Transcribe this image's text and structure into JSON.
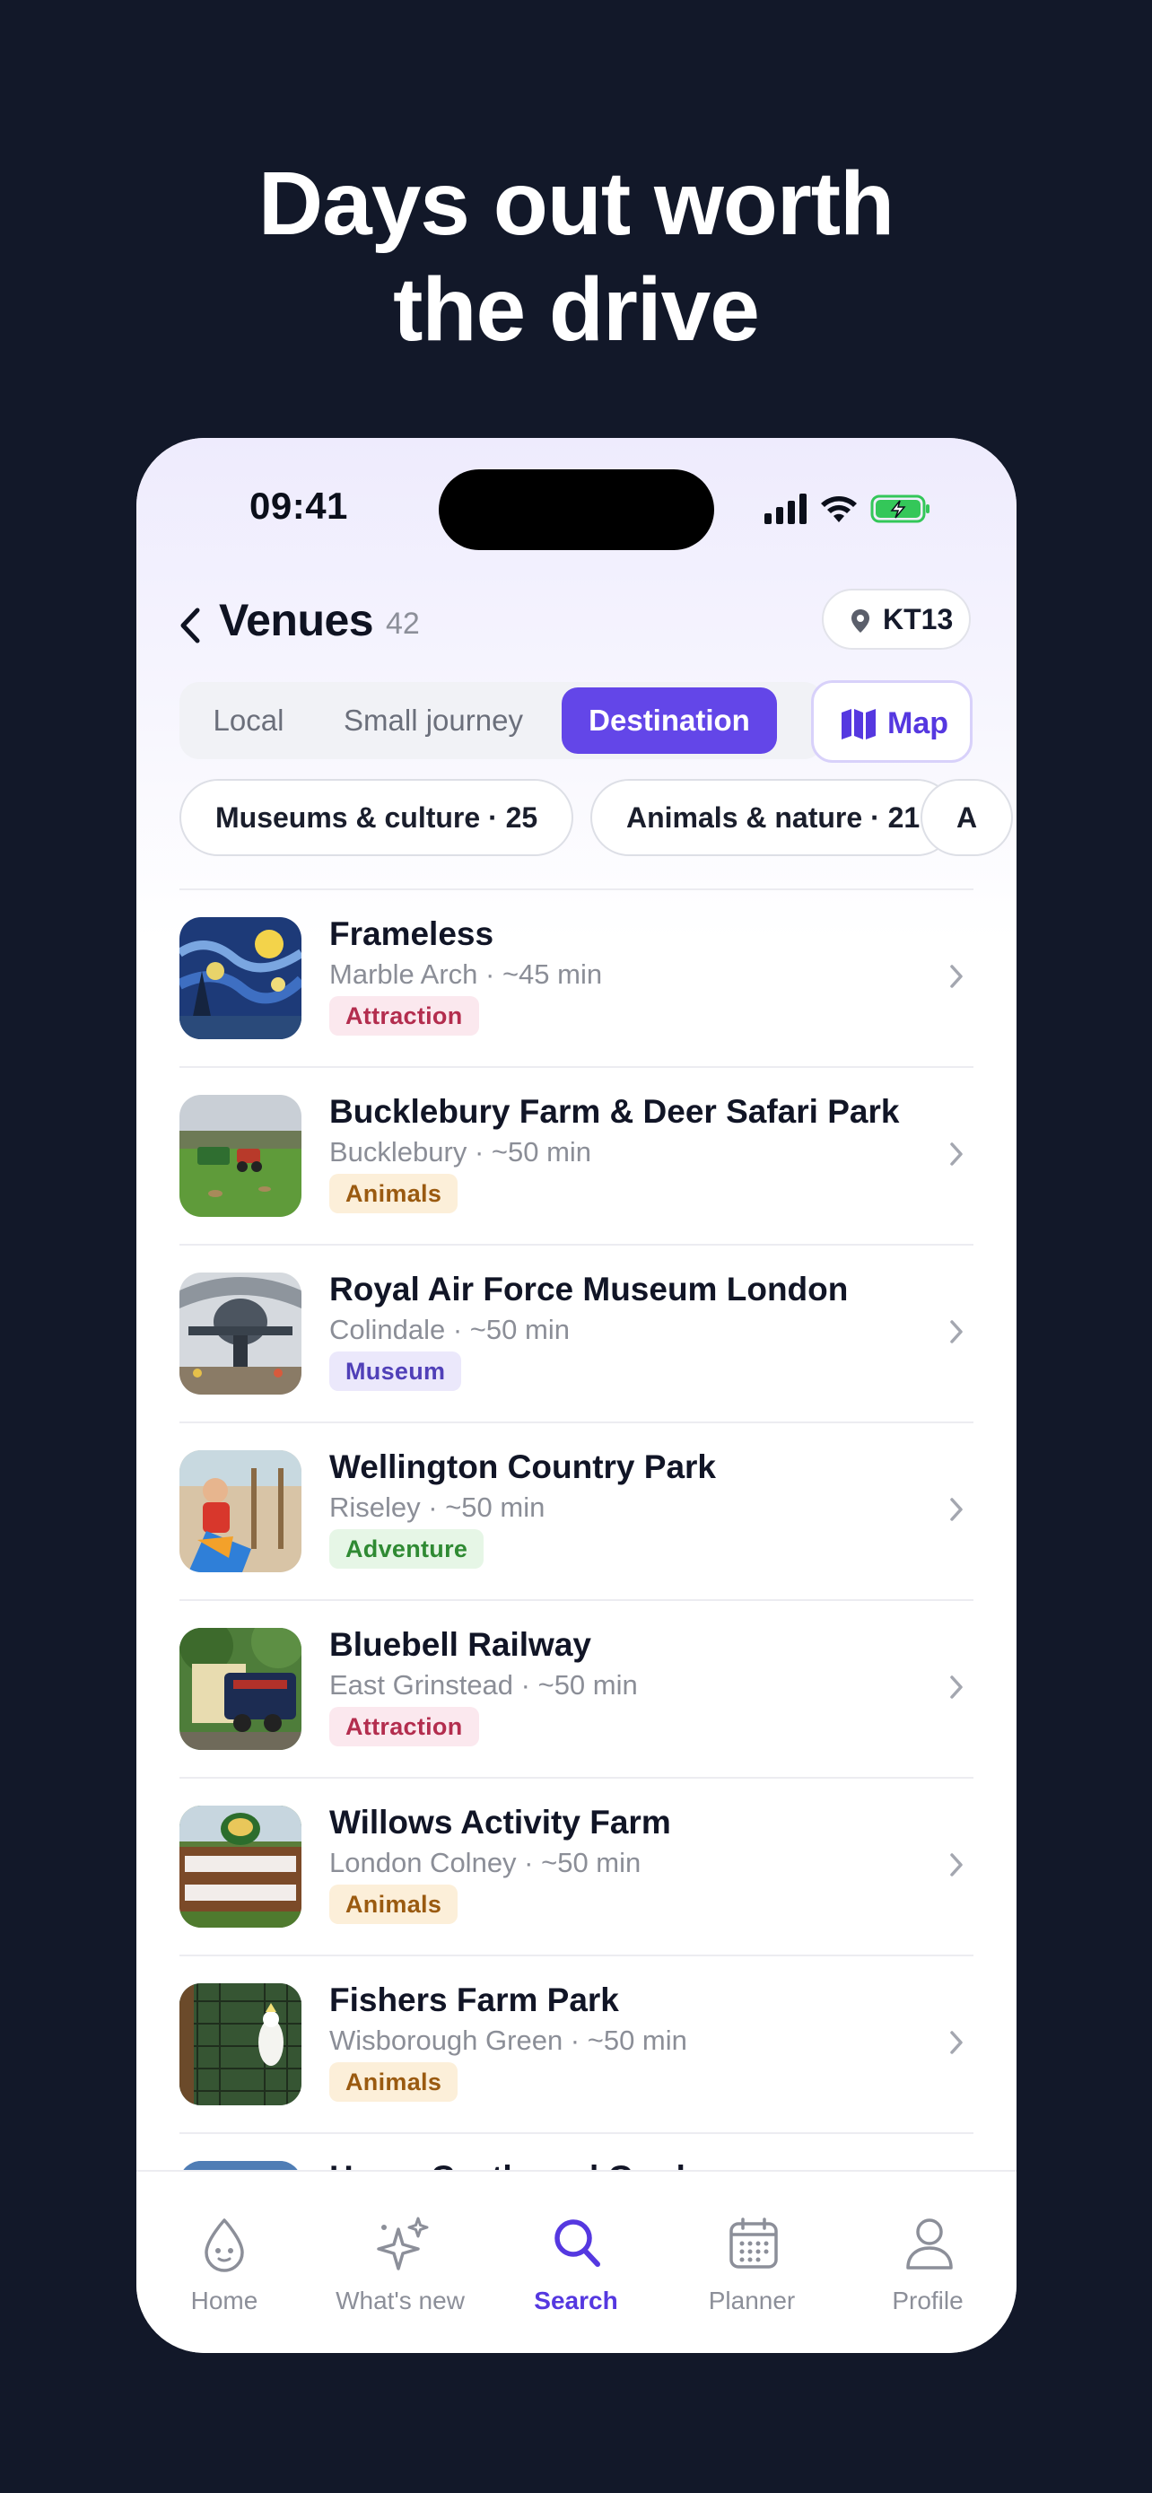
{
  "headline": {
    "line1": "Days out worth",
    "line2": "the drive"
  },
  "status_bar": {
    "time": "09:41",
    "icons": [
      "cellular-signal-icon",
      "wifi-icon",
      "battery-charging-icon"
    ]
  },
  "header": {
    "title": "Venues",
    "count": "42",
    "back_icon": "chevron-left-icon",
    "location_icon": "location-pin-icon",
    "location_label": "KT13"
  },
  "segments": {
    "items": [
      "Local",
      "Small journey",
      "Destination"
    ],
    "active_index": 2
  },
  "map_button": {
    "icon": "map-icon",
    "label": "Map"
  },
  "category_chips": [
    "Museums & culture · 25",
    "Animals & nature · 21",
    "A"
  ],
  "venues": [
    {
      "name": "Frameless",
      "subtitle": "Marble Arch · ~45 min",
      "badge": "Attraction",
      "badge_bg": "#fbe8ee",
      "badge_fg": "#b32d4e",
      "image": "starry-night-painting"
    },
    {
      "name": "Bucklebury Farm & Deer Safari Park",
      "subtitle": "Bucklebury · ~50 min",
      "badge": "Animals",
      "badge_bg": "#fcefd9",
      "badge_fg": "#9a5a10",
      "image": "farm-field-tractor"
    },
    {
      "name": "Royal Air Force Museum London",
      "subtitle": "Colindale · ~50 min",
      "badge": "Museum",
      "badge_bg": "#ebe8fb",
      "badge_fg": "#5040b8",
      "image": "aircraft-hangar"
    },
    {
      "name": "Wellington Country Park",
      "subtitle": "Riseley · ~50 min",
      "badge": "Adventure",
      "badge_bg": "#e6f6e6",
      "badge_fg": "#2f8a33",
      "image": "child-on-slide"
    },
    {
      "name": "Bluebell Railway",
      "subtitle": "East Grinstead · ~50 min",
      "badge": "Attraction",
      "badge_bg": "#fbe8ee",
      "badge_fg": "#b32d4e",
      "image": "steam-locomotive"
    },
    {
      "name": "Willows Activity Farm",
      "subtitle": "London Colney · ~50 min",
      "badge": "Animals",
      "badge_bg": "#fcefd9",
      "badge_fg": "#9a5a10",
      "image": "welcome-sign"
    },
    {
      "name": "Fishers Farm Park",
      "subtitle": "Wisborough Green · ~50 min",
      "badge": "Animals",
      "badge_bg": "#fcefd9",
      "badge_fg": "#9a5a10",
      "image": "white-cockatoo"
    },
    {
      "name": "Hever Castle and Gardens",
      "subtitle": "",
      "badge": "",
      "image": "sky"
    }
  ],
  "tab_bar": {
    "items": [
      {
        "label": "Home",
        "icon": "droplet-face-icon"
      },
      {
        "label": "What's new",
        "icon": "sparkles-icon"
      },
      {
        "label": "Search",
        "icon": "search-icon"
      },
      {
        "label": "Planner",
        "icon": "calendar-icon"
      },
      {
        "label": "Profile",
        "icon": "person-icon"
      }
    ],
    "active_index": 2
  },
  "colors": {
    "page_background": "#121829",
    "accent": "#6346e8",
    "accent_text": "#5538e0"
  }
}
